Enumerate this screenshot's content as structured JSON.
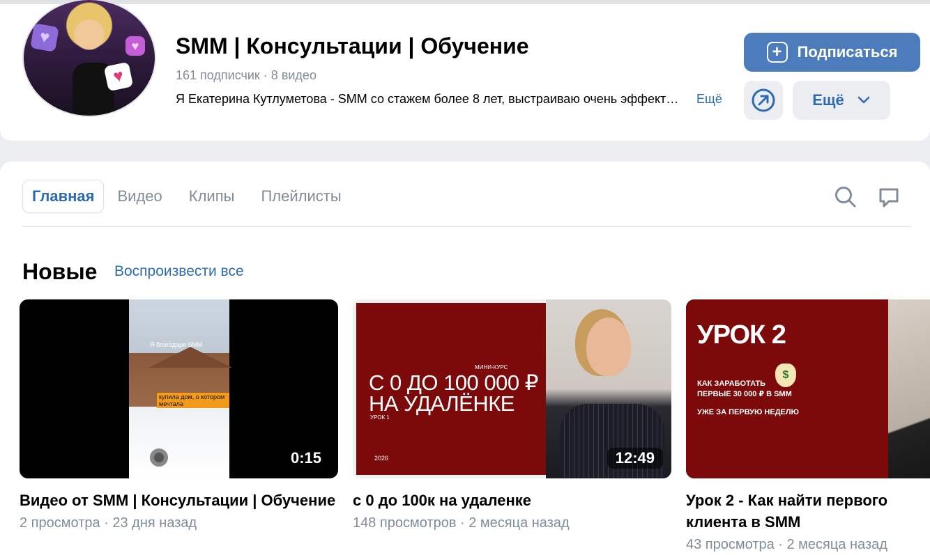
{
  "channel": {
    "title": "SMM | Консультации | Обучение",
    "meta": "161 подписчик · 8 видео",
    "description": "Я Екатерина Кутлуметова - SMM  со стажем более 8 лет, выстраиваю очень эффективные стратегии",
    "description_more": "Ещё",
    "subscribe_label": "Подписаться",
    "more_label": "Ещё"
  },
  "tabs": [
    {
      "label": "Главная",
      "active": true
    },
    {
      "label": "Видео",
      "active": false
    },
    {
      "label": "Клипы",
      "active": false
    },
    {
      "label": "Плейлисты",
      "active": false
    }
  ],
  "section": {
    "title": "Новые",
    "play_all": "Воспроизвести все"
  },
  "videos": [
    {
      "title": "Видео от SMM | Консультации | Обучение",
      "meta": "2 просмотра · 23 дня назад",
      "duration": "0:15",
      "thumb_caption": "Я благодаря SMM",
      "thumb_label": "купила дом, о котором мечтала"
    },
    {
      "title": "с 0 до 100к на удаленке",
      "meta": "148 просмотров · 2 месяца назад",
      "duration": "12:49",
      "thumb_headline": "С 0 ДО 100 000 ₽ НА УДАЛЁНКЕ",
      "thumb_tag": "МИНИ-КУРС",
      "thumb_lesson": "УРОК 1",
      "thumb_year": "2026"
    },
    {
      "title": "Урок 2 - Как найти первого клиента в SMM",
      "meta": "43 просмотра · 2 месяца назад",
      "thumb_big": "УРОК 2",
      "thumb_line1": "КАК ЗАРАБОТАТЬ",
      "thumb_line2": "ПЕРВЫЕ 30 000 ₽ В SMM",
      "thumb_line3": "УЖЕ ЗА ПЕРВУЮ НЕДЕЛЮ"
    }
  ],
  "icons": {
    "search": "search-icon",
    "comment": "comment-icon",
    "share": "share-icon",
    "plus": "plus-icon",
    "chevron": "chevron-down-icon"
  },
  "colors": {
    "accent": "#4d7cbd",
    "link": "#2d6bb0",
    "muted": "#818c99"
  }
}
